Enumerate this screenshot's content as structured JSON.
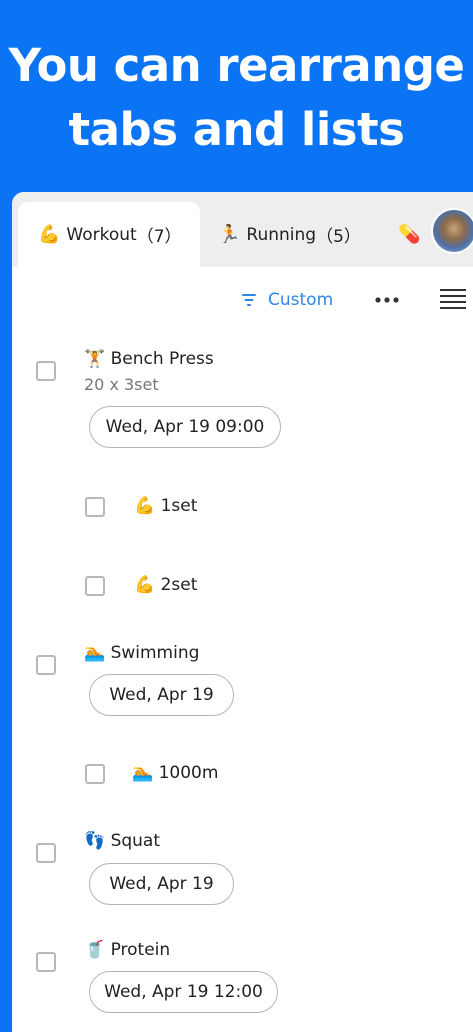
{
  "promo": {
    "headline_line1": "You can rearrange",
    "headline_line2": "tabs and lists"
  },
  "tabs": [
    {
      "emoji": "💪",
      "label": "Workout",
      "count": "（7）",
      "active": true
    },
    {
      "emoji": "🏃",
      "label": "Running",
      "count": "（5）",
      "active": false
    },
    {
      "emoji": "💊",
      "label": "",
      "count": "",
      "active": false
    }
  ],
  "toolbar": {
    "filter_label": "Custom",
    "more_icon": "•••"
  },
  "tasks": [
    {
      "emoji": "🏋",
      "title": "Bench Press",
      "note": "20 x 3set",
      "date": "Wed, Apr 19 09:00"
    },
    {
      "emoji": "💪",
      "title": "1set"
    },
    {
      "emoji": "💪",
      "title": "2set"
    },
    {
      "emoji": "🏊",
      "title": "Swimming",
      "date": "Wed, Apr 19"
    },
    {
      "emoji": "🏊",
      "title": "1000m"
    },
    {
      "emoji": "👣",
      "title": "Squat",
      "date": "Wed, Apr 19"
    },
    {
      "emoji": "🥤",
      "title": "Protein",
      "date": "Wed, Apr 19 12:00"
    }
  ],
  "colors": {
    "background": "#0a74f5",
    "accent": "#2f86e6",
    "tabbar": "#eeeeee"
  }
}
